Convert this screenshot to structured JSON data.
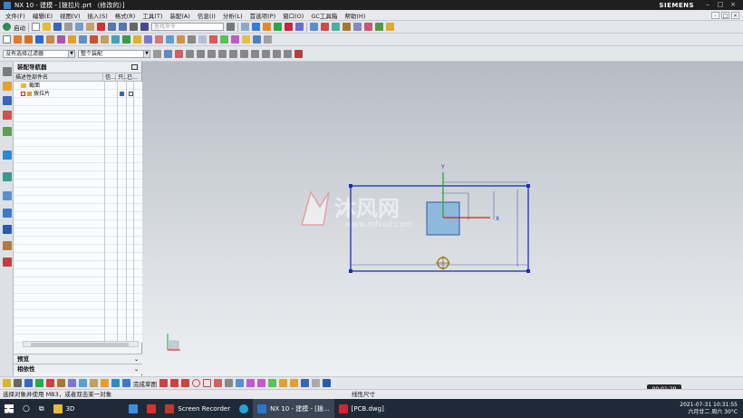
{
  "window": {
    "title": "NX 10 - 建模 - [拨拉片.prt （修改的）]",
    "brand": "SIEMENS"
  },
  "menu": {
    "items": [
      "文件(F)",
      "编辑(E)",
      "视图(V)",
      "插入(S)",
      "格式(R)",
      "工具(T)",
      "装配(A)",
      "信息(I)",
      "分析(L)",
      "首选项(P)",
      "窗口(O)",
      "GC工具箱",
      "帮助(H)"
    ]
  },
  "toolbar": {
    "start_label": "启动",
    "search_placeholder": "查找命令",
    "filter_value": "没有选择过滤器",
    "assembly_scope_value": "整个装配"
  },
  "nav": {
    "title": "装配导航器",
    "columns": [
      "描述性部件名",
      "信...",
      "只...",
      "已..."
    ],
    "rows": [
      {
        "label": "截面"
      },
      {
        "label": "拨拉片"
      }
    ],
    "sections": [
      "预览",
      "相依性"
    ]
  },
  "bottom_toolbar": {
    "finish_sketch_label": "完成草图"
  },
  "status": {
    "prompt": "选择对象并使用 MB3，或者双击某一对象",
    "hint": "线性尺寸"
  },
  "watermark": {
    "brand": "沐风网",
    "url": "www.mfcad.com"
  },
  "sketch": {
    "x_axis_label": "X",
    "y_axis_label": "Y"
  },
  "taskbar": {
    "items": [
      {
        "label": "3D",
        "color": "#e8b93c"
      },
      {
        "label": "",
        "color": "#3c8fe0"
      },
      {
        "label": "",
        "color": "#d9302b"
      },
      {
        "label": "Screen Recorder",
        "color": "#c0392b"
      },
      {
        "label": "",
        "color": "#1ea7d6"
      },
      {
        "label": "NX 10 - 建模 - [拨...",
        "color": "#2b77c8"
      },
      {
        "label": "[PCB.dwg]",
        "color": "#d1242f"
      }
    ],
    "time": "2021-07-31 10:31:55",
    "date": "六月廿二 周六 30°C"
  },
  "recorder_timer": "00:01:29",
  "colors": {
    "sketch_line": "#1a2fb5",
    "datum_x": "#d02020",
    "datum_y": "#20a040",
    "sketch_fill": "#8fb9dc"
  }
}
